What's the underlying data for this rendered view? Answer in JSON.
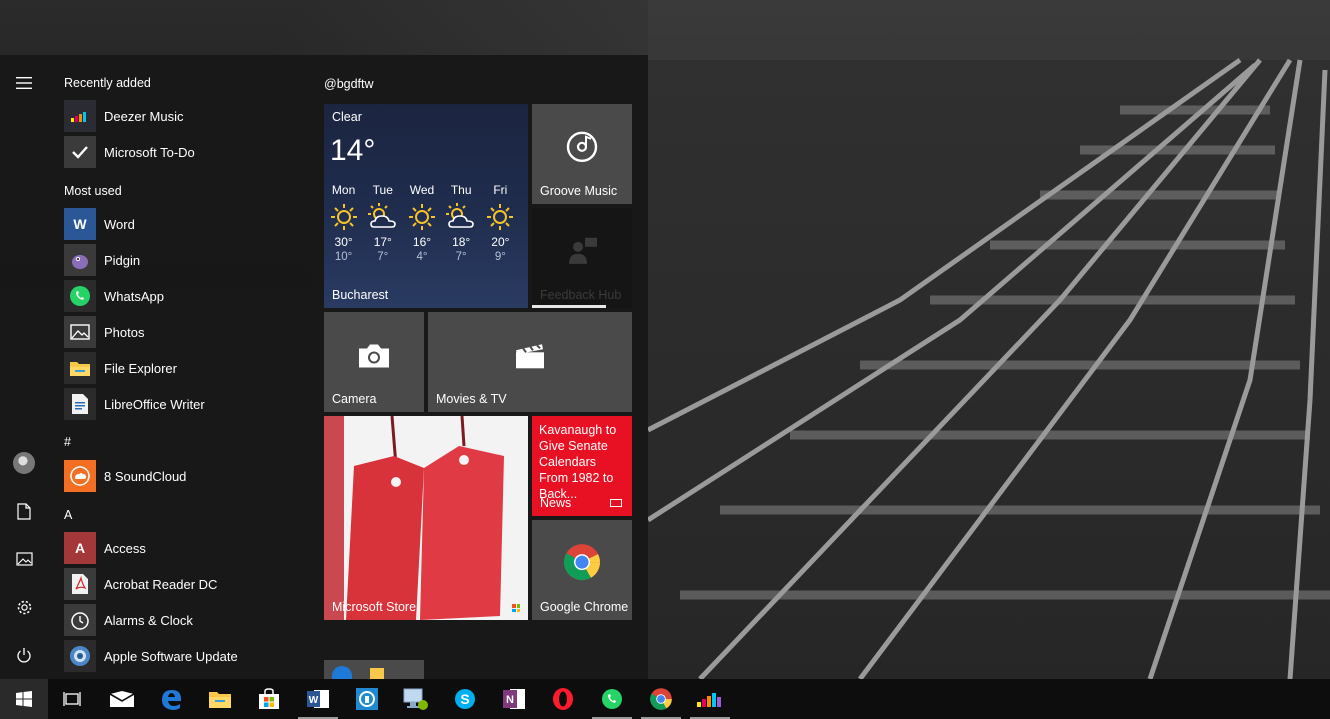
{
  "start_menu": {
    "rail": {
      "icons": [
        "hamburger-icon",
        "user-avatar",
        "documents-icon",
        "pictures-icon",
        "settings-icon",
        "power-icon"
      ]
    },
    "app_list": {
      "recently_added_header": "Recently added",
      "recently_added": [
        {
          "label": "Deezer Music",
          "icon": "deezer-icon"
        },
        {
          "label": "Microsoft To-Do",
          "icon": "todo-icon"
        }
      ],
      "most_used_header": "Most used",
      "most_used": [
        {
          "label": "Word",
          "icon": "word-icon"
        },
        {
          "label": "Pidgin",
          "icon": "pidgin-icon"
        },
        {
          "label": "WhatsApp",
          "icon": "whatsapp-icon"
        },
        {
          "label": "Photos",
          "icon": "photos-icon"
        },
        {
          "label": "File Explorer",
          "icon": "file-explorer-icon"
        },
        {
          "label": "LibreOffice Writer",
          "icon": "libreoffice-writer-icon"
        }
      ],
      "hash_header": "#",
      "hash_apps": [
        {
          "label": "8 SoundCloud",
          "icon": "soundcloud-icon"
        }
      ],
      "a_header": "A",
      "a_apps": [
        {
          "label": "Access",
          "icon": "access-icon"
        },
        {
          "label": "Acrobat Reader DC",
          "icon": "acrobat-icon"
        },
        {
          "label": "Alarms & Clock",
          "icon": "alarm-clock-icon"
        },
        {
          "label": "Apple Software Update",
          "icon": "apple-update-icon"
        }
      ]
    },
    "tiles": {
      "group_title": "@bgdftw",
      "weather": {
        "condition": "Clear",
        "temperature": "14°",
        "city": "Bucharest",
        "days": [
          {
            "name": "Mon",
            "icon": "sun-icon",
            "high": "30°",
            "low": "10°"
          },
          {
            "name": "Tue",
            "icon": "partly-cloudy-icon",
            "high": "17°",
            "low": "7°"
          },
          {
            "name": "Wed",
            "icon": "sun-icon",
            "high": "16°",
            "low": "4°"
          },
          {
            "name": "Thu",
            "icon": "partly-cloudy-icon",
            "high": "18°",
            "low": "7°"
          },
          {
            "name": "Fri",
            "icon": "sun-icon",
            "high": "20°",
            "low": "9°"
          }
        ]
      },
      "groove": {
        "label": "Groove Music"
      },
      "feedback": {
        "label": "Feedback Hub"
      },
      "camera": {
        "label": "Camera"
      },
      "movies": {
        "label": "Movies & TV"
      },
      "store": {
        "label": "Microsoft Store"
      },
      "news": {
        "headline": "Kavanaugh to Give Senate Calendars From 1982 to Back...",
        "label": "News"
      },
      "chrome": {
        "label": "Google Chrome"
      }
    }
  },
  "taskbar": {
    "items": [
      "start-button",
      "task-view-icon",
      "mail-icon",
      "edge-icon",
      "file-explorer-icon",
      "store-icon",
      "word-icon",
      "keepass-icon",
      "remote-desktop-icon",
      "skype-icon",
      "onenote-icon",
      "opera-icon",
      "whatsapp-icon",
      "chrome-icon",
      "deezer-icon"
    ]
  },
  "colors": {
    "accent_red": "#e81123",
    "tile_gray": "#4a4a4a",
    "menu_bg": "#181818",
    "taskbar_bg": "#0d0d0d"
  }
}
